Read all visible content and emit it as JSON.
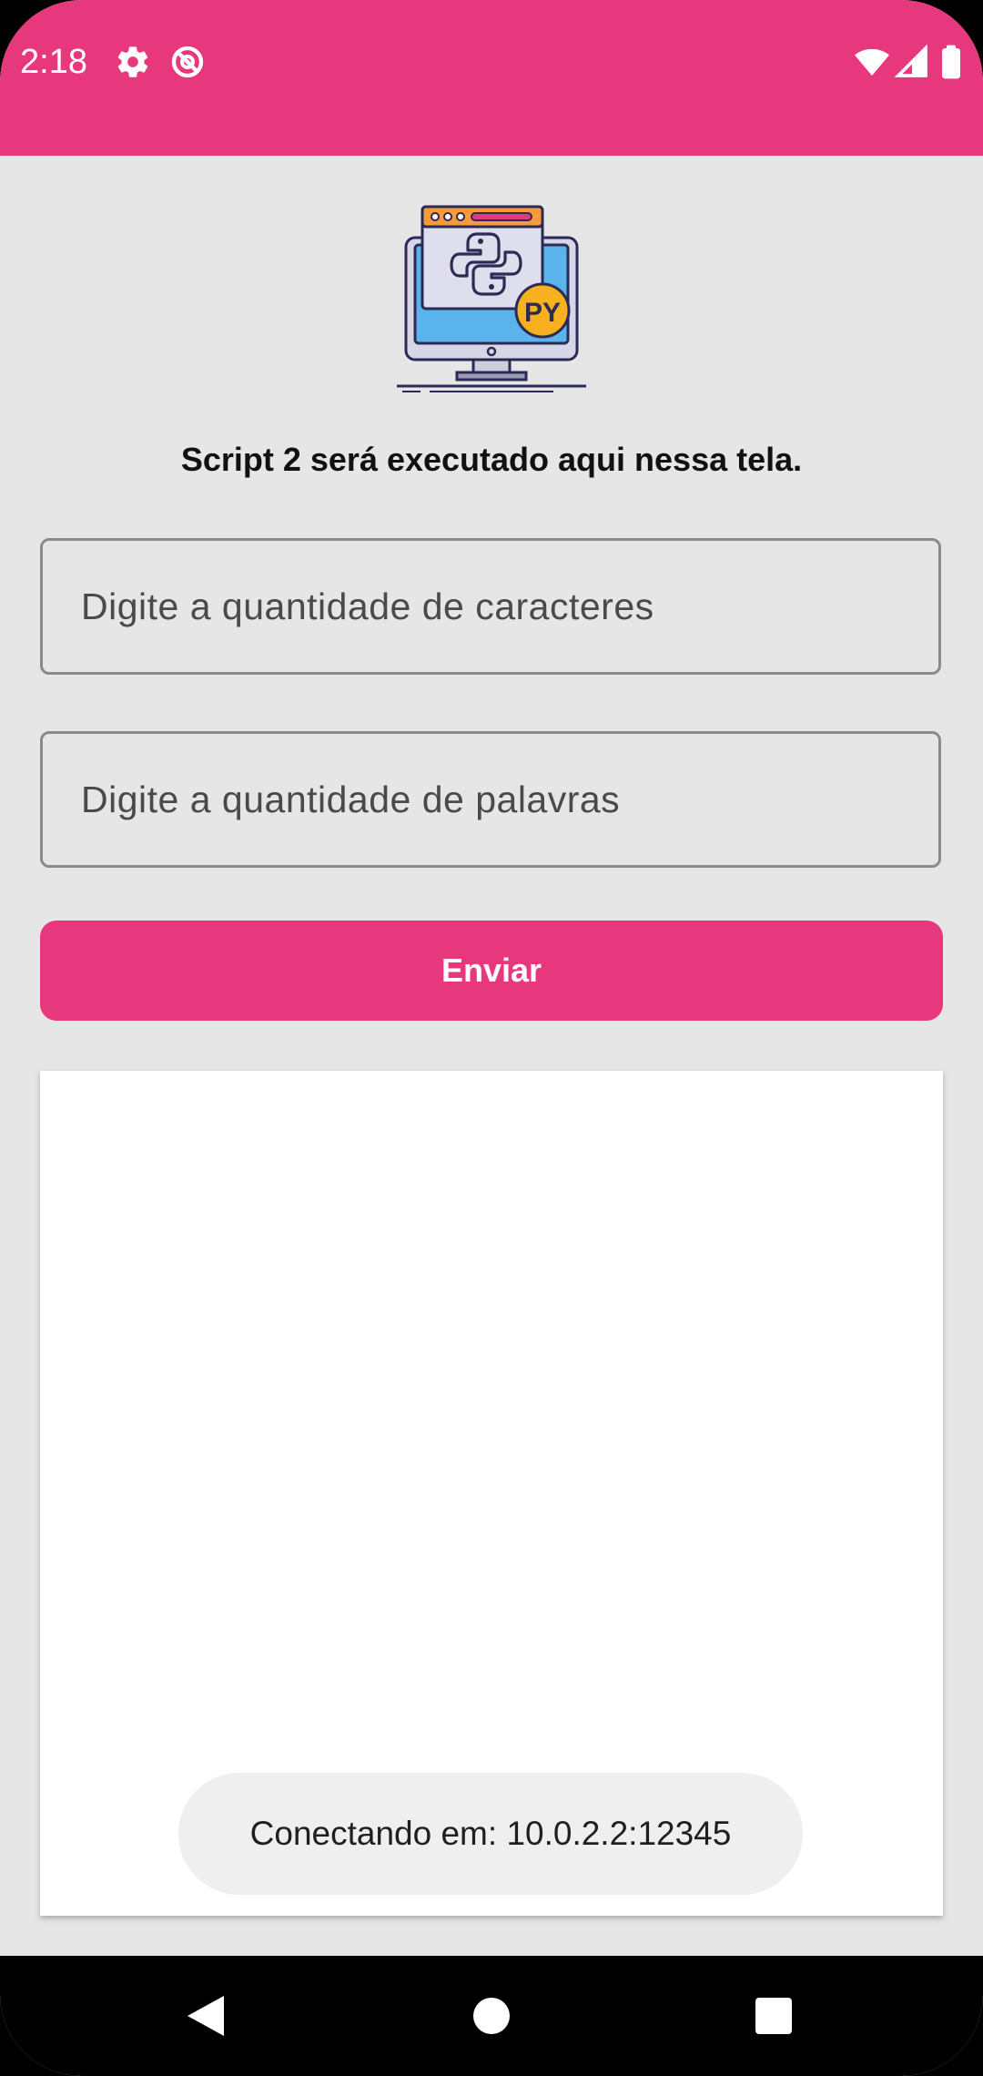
{
  "status_bar": {
    "time": "2:18",
    "icons_left": [
      "settings-gear-icon",
      "no-sync-icon"
    ],
    "icons_right": [
      "wifi-icon",
      "cell-signal-icon",
      "battery-icon"
    ],
    "background_color": "#e8387d"
  },
  "header": {
    "logo_icon": "python-monitor-icon",
    "logo_badge": "PY",
    "title": "Script 2 será executado aqui nessa tela."
  },
  "form": {
    "characters_placeholder": "Digite a quantidade de caracteres",
    "characters_value": "",
    "words_placeholder": "Digite a quantidade de palavras",
    "words_value": "",
    "submit_label": "Enviar"
  },
  "output": {
    "content": ""
  },
  "toast": {
    "message": "Conectando em: 10.0.2.2:12345"
  },
  "nav_bar": {
    "buttons": [
      "back-icon",
      "home-icon",
      "recents-icon"
    ]
  },
  "colors": {
    "accent": "#e8387d",
    "background": "#e6e6e6",
    "panel": "#ffffff"
  }
}
